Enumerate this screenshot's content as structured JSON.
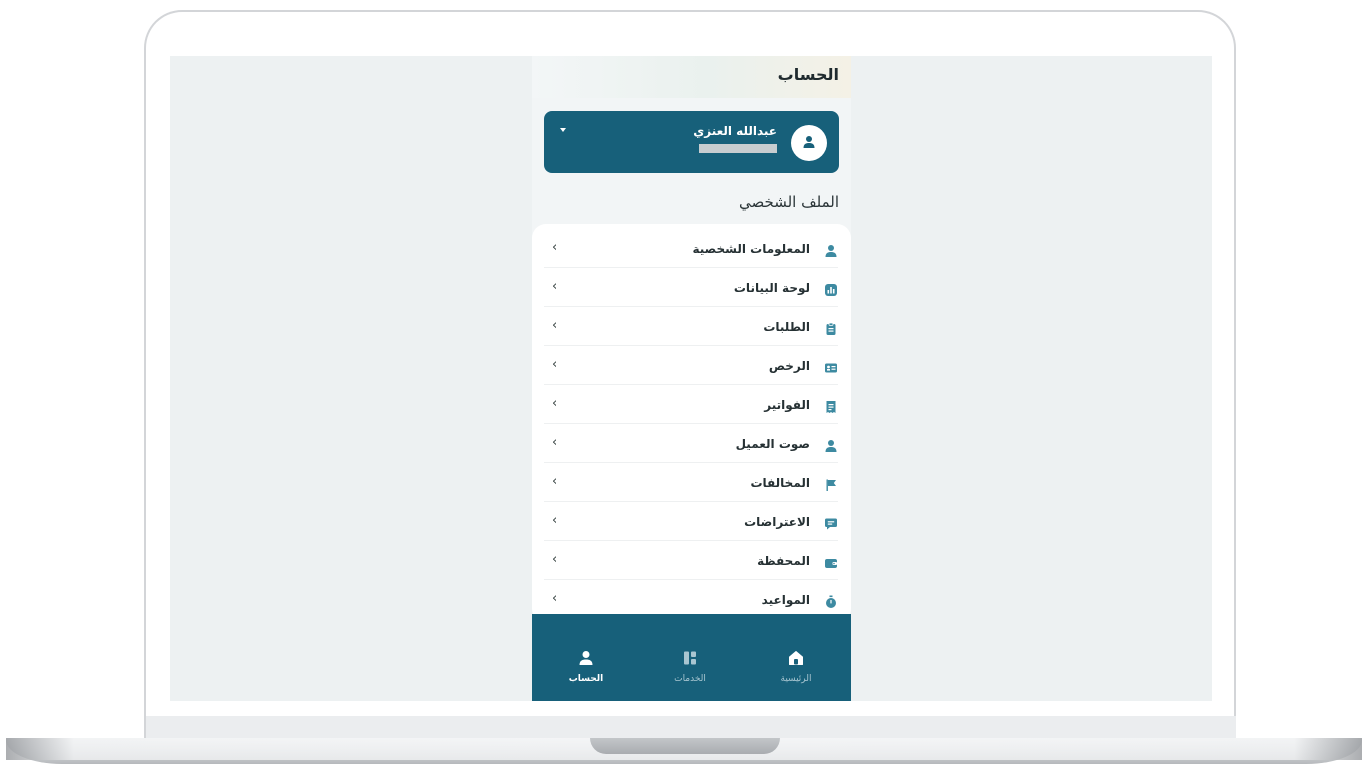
{
  "header": {
    "title": "الحساب"
  },
  "account": {
    "name": "عبدالله العنزي"
  },
  "profile": {
    "section_title": "الملف الشخصي"
  },
  "menu": [
    {
      "label": "المعلومات الشخصية",
      "icon": "person-icon"
    },
    {
      "label": "لوحة البيانات",
      "icon": "dashboard-icon"
    },
    {
      "label": "الطلبات",
      "icon": "clipboard-icon"
    },
    {
      "label": "الرخص",
      "icon": "id-card-icon"
    },
    {
      "label": "الفواتير",
      "icon": "receipt-icon"
    },
    {
      "label": "صوت العميل",
      "icon": "person-icon"
    },
    {
      "label": "المخالفات",
      "icon": "flag-icon"
    },
    {
      "label": "الاعتراضات",
      "icon": "comment-icon"
    },
    {
      "label": "المحفظة",
      "icon": "wallet-icon"
    },
    {
      "label": "المواعيد",
      "icon": "stopwatch-icon"
    }
  ],
  "nav": {
    "home": "الرئيسية",
    "services": "الخدمات",
    "account": "الحساب",
    "active": "account"
  },
  "colors": {
    "primary": "#17607a",
    "icon_accent": "#3d8aa1"
  }
}
